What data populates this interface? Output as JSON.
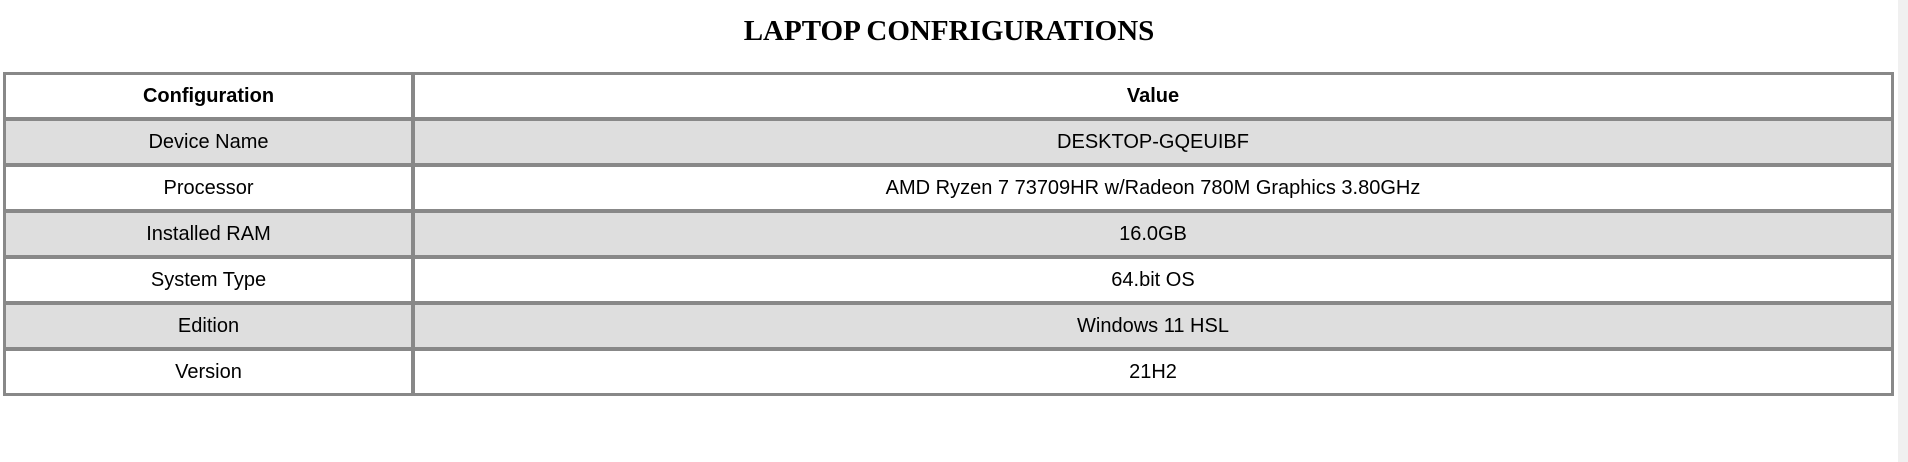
{
  "title": "LAPTOP CONFRIGURATIONS",
  "table": {
    "headers": [
      "Configuration",
      "Value"
    ],
    "rows": [
      [
        "Device Name",
        "DESKTOP-GQEUIBF"
      ],
      [
        "Processor",
        "AMD Ryzen 7 73709HR w/Radeon 780M Graphics 3.80GHz"
      ],
      [
        "Installed RAM",
        "16.0GB"
      ],
      [
        "System Type",
        "64.bit OS"
      ],
      [
        "Edition",
        "Windows 11 HSL"
      ],
      [
        "Version",
        "21H2"
      ]
    ]
  },
  "colors": {
    "border": "#888888",
    "row_shade": "#dedede",
    "row_plain": "#ffffff"
  }
}
